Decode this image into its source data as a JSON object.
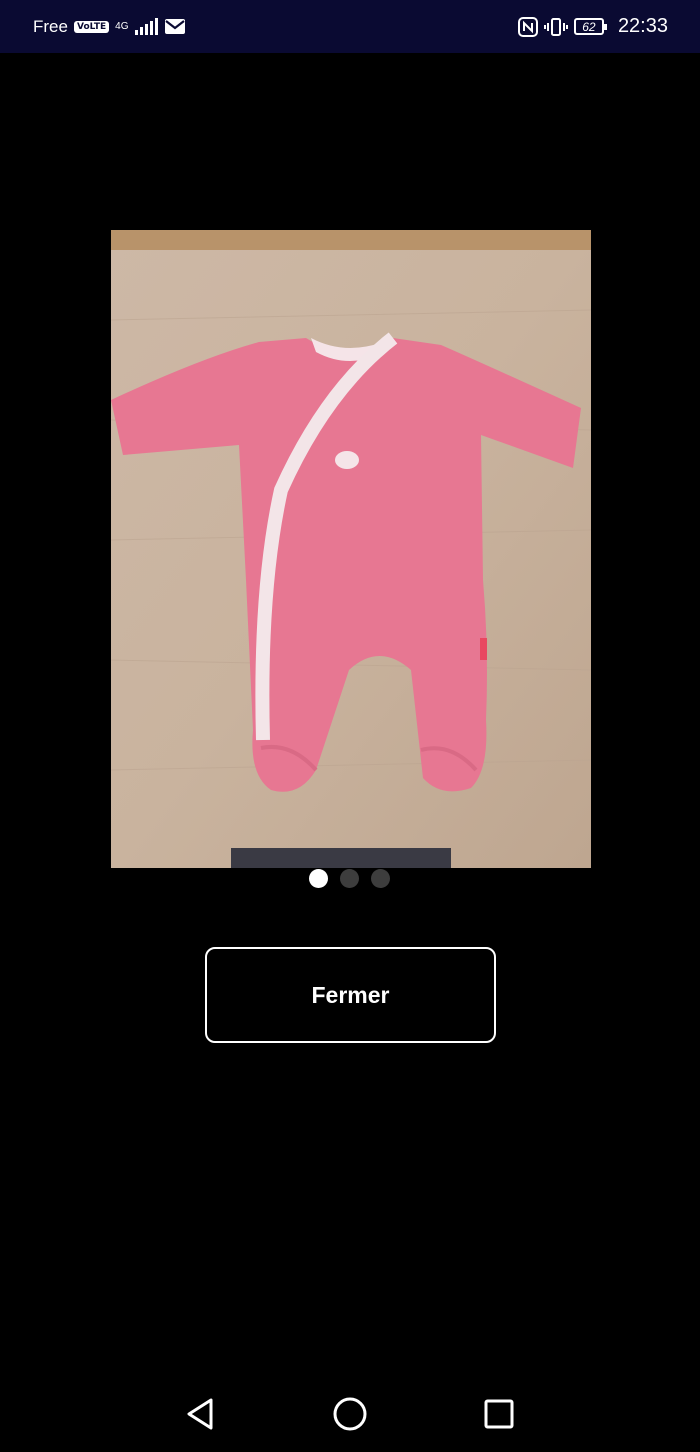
{
  "status_bar": {
    "carrier": "Free",
    "volte": "VoLTE",
    "network": "4G",
    "battery": "62",
    "time": "22:33",
    "icons": [
      "signal-icon",
      "mail-icon",
      "nfc-icon",
      "vibrate-icon",
      "battery-icon"
    ]
  },
  "viewer": {
    "image_count": 3,
    "active_index": 0
  },
  "close_button": {
    "label": "Fermer"
  },
  "nav": {
    "icons": [
      "back-icon",
      "home-icon",
      "recents-icon"
    ]
  },
  "colors": {
    "statusbar_bg": "#0a0a32",
    "background": "#000000",
    "dot_active": "#ffffff",
    "dot_inactive": "#3d3d3d"
  }
}
